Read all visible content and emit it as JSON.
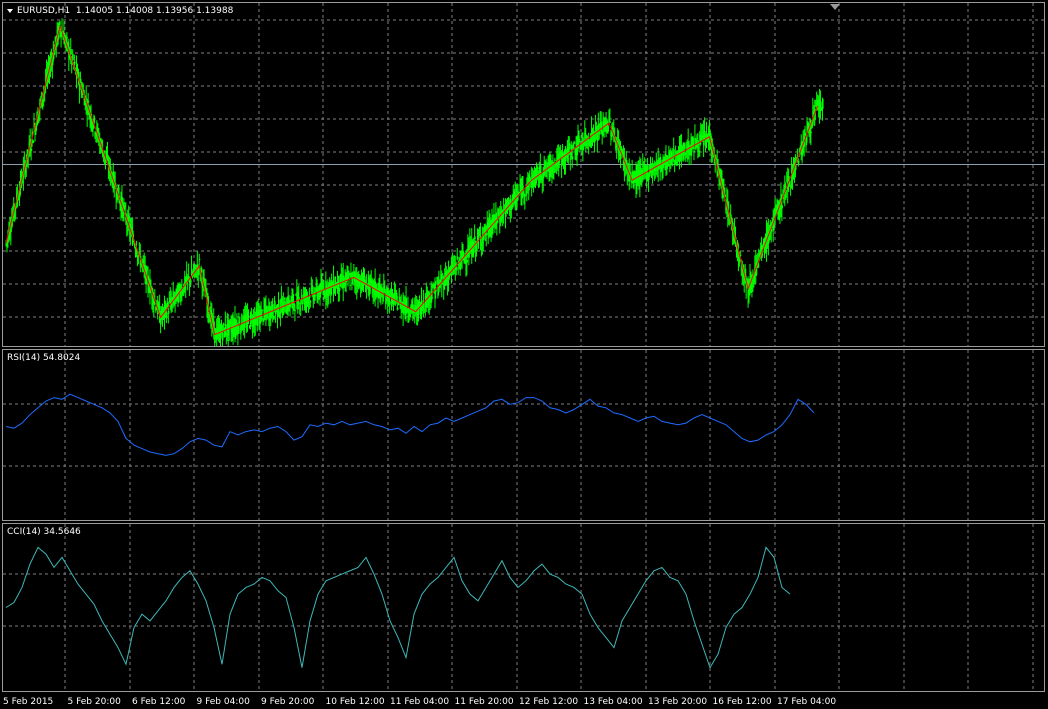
{
  "main": {
    "symbol": "EURUSD,H1",
    "ohlc": "1.14005 1.14008 1.13956 1.13988"
  },
  "rsi": {
    "label": "RSI(14) 54.8024"
  },
  "cci": {
    "label": "CCI(14) 34.5646"
  },
  "time_axis": {
    "labels": [
      "5 Feb 2015",
      "5 Feb 20:00",
      "6 Feb 12:00",
      "9 Feb 04:00",
      "9 Feb 20:00",
      "10 Feb 12:00",
      "11 Feb 04:00",
      "11 Feb 20:00",
      "12 Feb 12:00",
      "13 Feb 04:00",
      "13 Feb 20:00",
      "16 Feb 12:00",
      "17 Feb 04:00"
    ]
  },
  "colors": {
    "background": "#000000",
    "grid": "#7f7f7f",
    "candles": "#00ff00",
    "zigzag": "#ff0000",
    "rsi_line": "#1e6bff",
    "cci_line": "#3fb7b7",
    "bid_line": "#8aa0b0",
    "frame": "#9a9a9a"
  },
  "icons": {
    "menu": "triangle-down-icon",
    "scroll": "scroll-shift-marker-icon"
  },
  "chart_data": [
    {
      "type": "candlestick",
      "name": "EURUSD,H1",
      "ylim": [
        1.124,
        1.154
      ],
      "current_bid": 1.13988,
      "zigzag": [
        {
          "x": 0,
          "y": 1.133
        },
        {
          "x": 7,
          "y": 1.152
        },
        {
          "x": 20,
          "y": 1.1265
        },
        {
          "x": 25,
          "y": 1.131
        },
        {
          "x": 27,
          "y": 1.125
        },
        {
          "x": 45,
          "y": 1.13
        },
        {
          "x": 53,
          "y": 1.127
        },
        {
          "x": 68,
          "y": 1.1385
        },
        {
          "x": 78,
          "y": 1.1435
        },
        {
          "x": 81,
          "y": 1.1385
        },
        {
          "x": 91,
          "y": 1.1423
        },
        {
          "x": 96,
          "y": 1.129
        },
        {
          "x": 105,
          "y": 1.145
        }
      ]
    },
    {
      "type": "line",
      "name": "RSI(14)",
      "ylim": [
        0,
        100
      ],
      "last": 54.8024,
      "values": [
        55,
        54,
        57,
        62,
        66,
        70,
        72,
        71,
        74,
        72,
        70,
        68,
        66,
        63,
        58,
        48,
        44,
        42,
        40,
        39,
        38,
        39,
        42,
        46,
        48,
        47,
        44,
        43,
        52,
        50,
        52,
        53,
        52,
        54,
        55,
        52,
        47,
        49,
        56,
        55,
        57,
        56,
        58,
        56,
        57,
        58,
        56,
        55,
        53,
        54,
        51,
        55,
        52,
        56,
        57,
        60,
        58,
        60,
        62,
        64,
        66,
        70,
        71,
        68,
        69,
        72,
        72,
        70,
        66,
        65,
        63,
        65,
        68,
        71,
        67,
        66,
        63,
        62,
        60,
        58,
        60,
        61,
        58,
        57,
        56,
        57,
        60,
        62,
        60,
        58,
        56,
        52,
        48,
        46,
        47,
        50,
        52,
        56,
        62,
        71,
        68,
        63
      ]
    },
    {
      "type": "line",
      "name": "CCI(14)",
      "ylim": [
        -250,
        250
      ],
      "last": 34.5646,
      "values": [
        0,
        15,
        60,
        130,
        180,
        160,
        120,
        150,
        110,
        70,
        40,
        10,
        -40,
        -80,
        -120,
        -170,
        -60,
        -20,
        -40,
        -10,
        20,
        60,
        90,
        110,
        70,
        20,
        -60,
        -170,
        -20,
        40,
        60,
        70,
        90,
        80,
        50,
        30,
        -60,
        -180,
        -40,
        40,
        80,
        90,
        100,
        110,
        120,
        150,
        100,
        40,
        -40,
        -90,
        -150,
        -20,
        40,
        70,
        90,
        120,
        150,
        80,
        40,
        20,
        60,
        100,
        140,
        90,
        60,
        80,
        110,
        130,
        100,
        90,
        70,
        60,
        40,
        -20,
        -60,
        -90,
        -120,
        -40,
        0,
        40,
        80,
        110,
        120,
        90,
        80,
        40,
        -40,
        -110,
        -180,
        -140,
        -60,
        -20,
        0,
        40,
        90,
        180,
        150,
        60,
        40
      ]
    }
  ]
}
